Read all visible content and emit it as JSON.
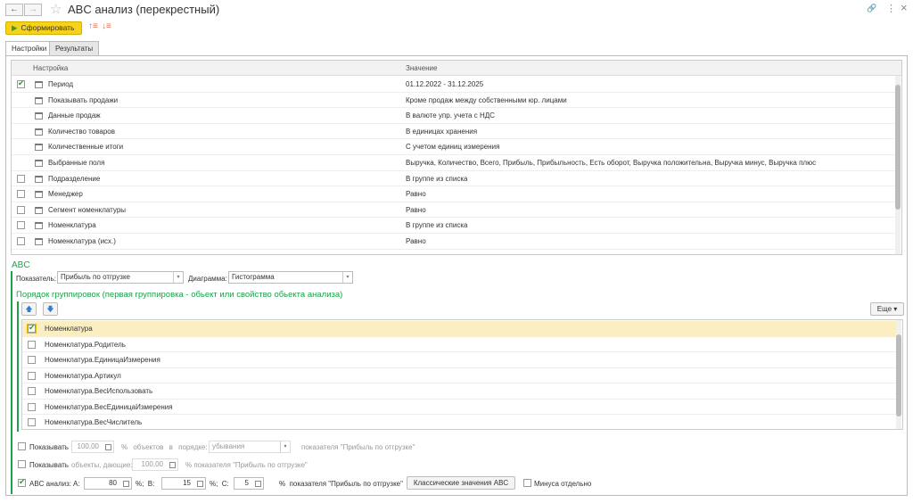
{
  "window": {
    "title": "ABC анализ (перекрестный)",
    "back": "←",
    "forward": "→",
    "star": "☆",
    "link_icon": "🔗",
    "more_icon": "⋮",
    "close_icon": "×"
  },
  "toolbar": {
    "generate": "Сформировать"
  },
  "tabs": [
    {
      "label": "Настройки",
      "active": true
    },
    {
      "label": "Результаты",
      "active": false
    }
  ],
  "settings": {
    "col_setting": "Настройка",
    "col_value": "Значение",
    "rows": [
      {
        "name": "Период",
        "value": "01.12.2022 - 31.12.2025",
        "checkbox": true,
        "checked": true
      },
      {
        "name": "Показывать продажи",
        "value": "Кроме продаж между собственными юр. лицами",
        "checkbox": false
      },
      {
        "name": "Данные продаж",
        "value": "В валюте упр. учета с НДС",
        "checkbox": false
      },
      {
        "name": "Количество товаров",
        "value": "В единицах хранения",
        "checkbox": false
      },
      {
        "name": "Количественные итоги",
        "value": "С учетом единиц измерения",
        "checkbox": false
      },
      {
        "name": "Выбранные поля",
        "value": "Выручка, Количество, Всего, Прибыль, Прибыльность, Есть оборот, Выручка положительна, Выручка минус, Выручка плюс",
        "checkbox": false
      },
      {
        "name": "Подразделение",
        "value": "В группе из списка",
        "checkbox": true,
        "checked": false
      },
      {
        "name": "Менеджер",
        "value": "Равно",
        "checkbox": true,
        "checked": false
      },
      {
        "name": "Сегмент номенклатуры",
        "value": "Равно",
        "checkbox": true,
        "checked": false
      },
      {
        "name": "Номенклатура",
        "value": "В группе из списка",
        "checkbox": true,
        "checked": false
      },
      {
        "name": "Номенклатура (исх.)",
        "value": "Равно",
        "checkbox": true,
        "checked": false
      }
    ]
  },
  "abc": {
    "heading": "ABC",
    "indicator_label": "Показатель:",
    "indicator": "Прибыль по отгрузке",
    "chart_label": "Диаграмма:",
    "chart": "Гистограмма",
    "grouping_heading": "Порядок группировок (первая группировка - обьект или свойство обьекта анализа)",
    "more": "Еще",
    "groups": [
      {
        "label": "Номенклатура",
        "checked": true
      },
      {
        "label": "Номенклатура.Родитель",
        "checked": false
      },
      {
        "label": "Номенклатура.ЕдиницаИзмерения",
        "checked": false
      },
      {
        "label": "Номенклатура.Артикул",
        "checked": false
      },
      {
        "label": "Номенклатура.ВесИспользовать",
        "checked": false
      },
      {
        "label": "Номенклатура.ВесЕдиницаИзмерения",
        "checked": false
      },
      {
        "label": "Номенклатура.ВесЧислитель",
        "checked": false
      }
    ]
  },
  "filter1": {
    "show": "Показывать",
    "value": "100,00",
    "pct_text": "% объектов в порядке:",
    "order": "убывания",
    "suffix": "показателя \"Прибыль по отгрузке\""
  },
  "filter2": {
    "show": "Показывать",
    "mid": "объекты, дающие:",
    "value": "100,00",
    "suffix": "%  показателя \"Прибыль по отгрузке\""
  },
  "abc_analysis": {
    "label": "ABC анализ:",
    "a_label": "A:",
    "a": "80",
    "b_label": "%;  B:",
    "b": "15",
    "c_label": "%;  C:",
    "c": "5",
    "suffix": "%  показателя \"Прибыль по отгрузке\"",
    "classic": "Классические значения ABC",
    "minus": "Минуса отдельно"
  }
}
